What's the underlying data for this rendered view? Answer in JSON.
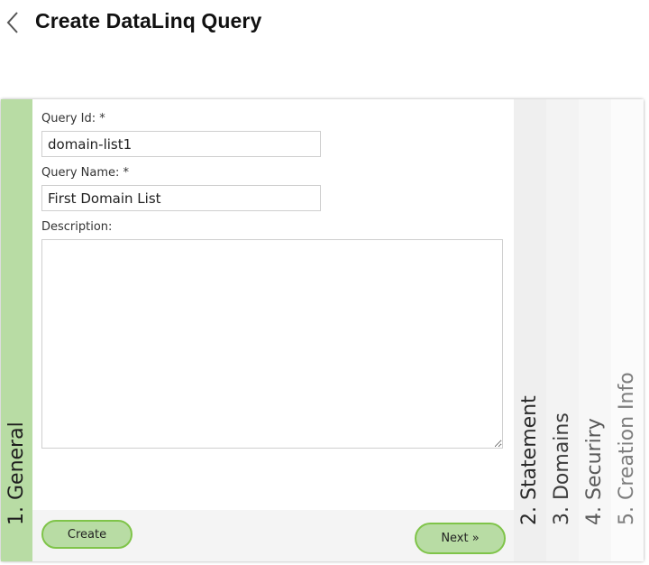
{
  "header": {
    "title": "Create DataLinq Query",
    "back_icon": "chevron-left-icon"
  },
  "steps": [
    {
      "label": "1.  General",
      "active": true
    },
    {
      "label": "2.  Statement",
      "active": false
    },
    {
      "label": "3.  Domains",
      "active": false
    },
    {
      "label": "4.  Securiry",
      "active": false
    },
    {
      "label": "5.  Creation Info",
      "active": false
    }
  ],
  "form": {
    "query_id_label": "Query Id: *",
    "query_id_value": "domain-list1",
    "query_name_label": "Query Name: *",
    "query_name_value": "First Domain List",
    "description_label": "Description:",
    "description_value": ""
  },
  "footer": {
    "create_label": "Create",
    "next_label": "Next »"
  },
  "colors": {
    "accent": "#b8dca4",
    "accent_border": "#7fc449"
  }
}
